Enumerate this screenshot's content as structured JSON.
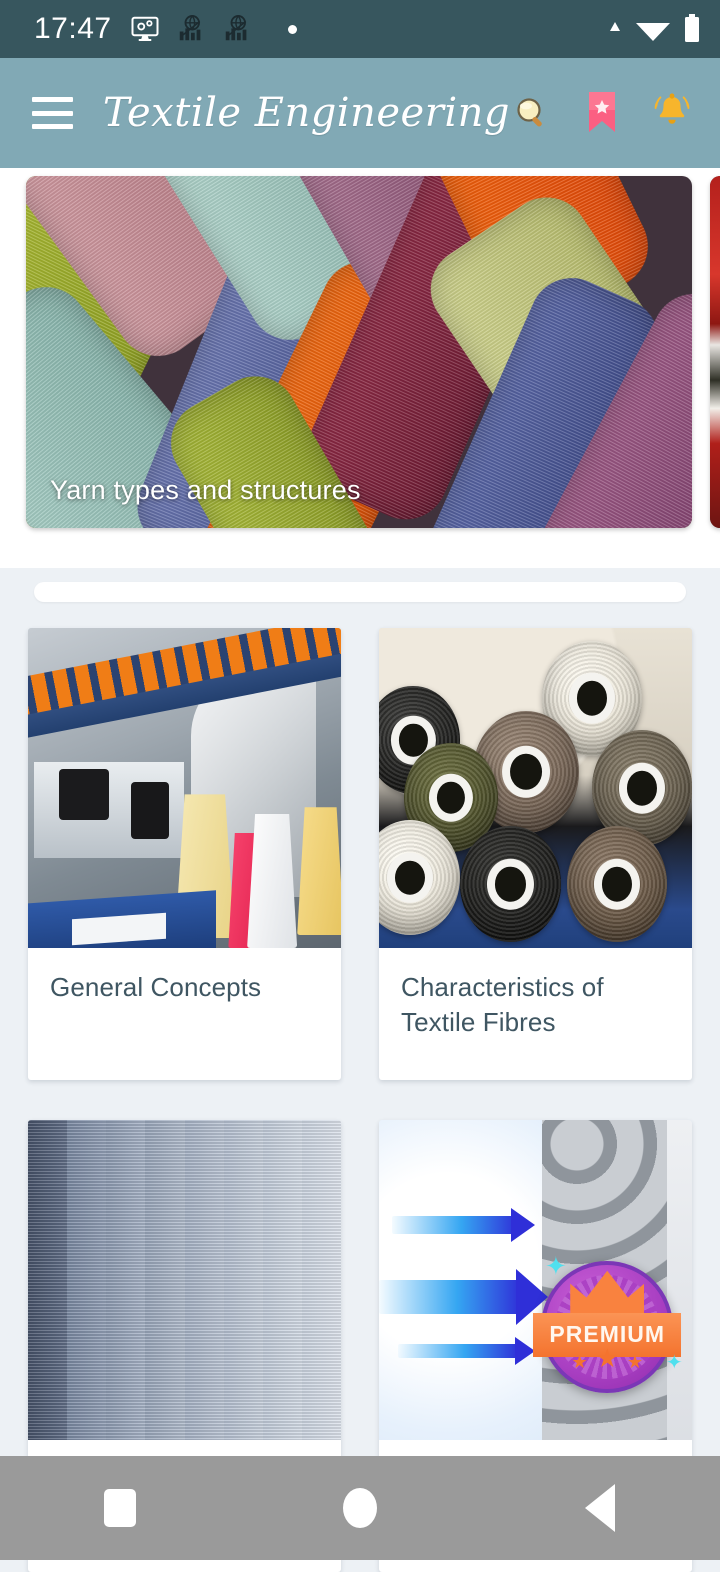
{
  "status_bar": {
    "time": "17:47",
    "left_icons": [
      "monitor-gear-icon",
      "globe-chart-icon",
      "globe-chart-icon",
      "dot-indicator"
    ],
    "right_icons": [
      "signal-triangle-icon",
      "wifi-icon",
      "battery-icon"
    ],
    "background_color": "#37565E"
  },
  "app_bar": {
    "menu_icon": "hamburger-menu-icon",
    "title": "Textile Engineering",
    "background_color": "#81A9B5",
    "actions": [
      {
        "name": "search",
        "glyph": "🔍"
      },
      {
        "name": "bookmark",
        "glyph": "🔖"
      },
      {
        "name": "notifications",
        "glyph": "🔔"
      }
    ]
  },
  "carousel": {
    "items": [
      {
        "caption": "Yarn types and structures",
        "art": "braided-yarn"
      },
      {
        "caption": "",
        "art": "red-fabric"
      }
    ]
  },
  "ad_bar": {
    "label": ""
  },
  "grid": {
    "cards": [
      {
        "title": "General Concepts",
        "art": "knitting-machine",
        "premium": false
      },
      {
        "title": "Characteristics of Textile Fibres",
        "art": "thread-spools",
        "premium": false
      },
      {
        "title": "",
        "art": "fabric-rolls",
        "premium": false
      },
      {
        "title": "",
        "art": "fibre-absorption-diagram",
        "premium": true,
        "badge_label": "PREMIUM"
      }
    ]
  },
  "nav_bar": {
    "background_color": "#9A9A9A",
    "buttons": [
      {
        "name": "recents",
        "shape": "square"
      },
      {
        "name": "home",
        "shape": "circle"
      },
      {
        "name": "back",
        "shape": "triangle-left"
      }
    ]
  },
  "colors": {
    "status_bar": "#37565E",
    "app_bar": "#81A9B5",
    "content_bg": "#EDF1F5",
    "card_title": "#3F5662",
    "nav_bar": "#9A9A9A",
    "premium_badge": "#A93FC2",
    "premium_ribbon": "#F4732E"
  }
}
